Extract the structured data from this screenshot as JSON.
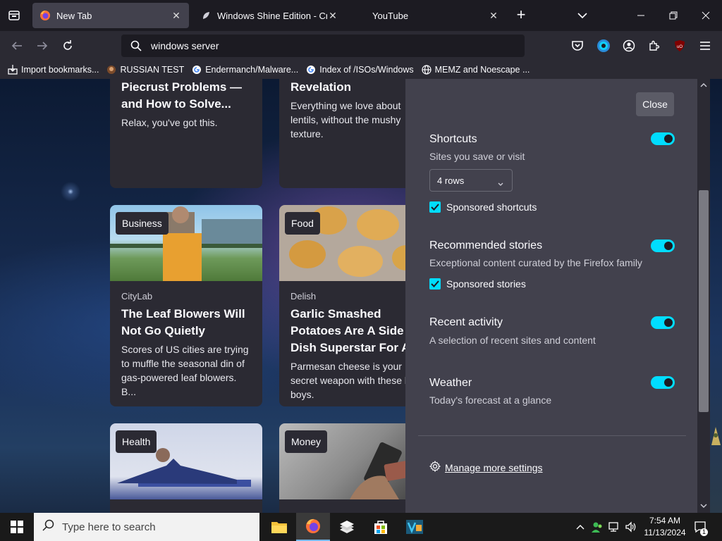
{
  "browser": {
    "tabs": [
      {
        "title": "New Tab",
        "active": true
      },
      {
        "title": "Windows Shine Edition - Crusty",
        "active": false
      },
      {
        "title": "YouTube",
        "active": false
      }
    ],
    "url_value": "windows server",
    "bookmarks": [
      {
        "label": "Import bookmarks..."
      },
      {
        "label": "RUSSIAN TEST"
      },
      {
        "label": "Endermanch/Malware..."
      },
      {
        "label": "Index of /ISOs/Windows"
      },
      {
        "label": "MEMZ and Noescape ..."
      }
    ],
    "accent": "#00ddff"
  },
  "cards": [
    {
      "headline": "Piecrust Problems — and How to Solve...",
      "excerpt": "Relax, you've got this."
    },
    {
      "headline": "Revelation",
      "excerpt": "Everything we love about lentils, without the mushy texture."
    },
    {
      "tag": "Business",
      "source": "CityLab",
      "headline": "The Leaf Blowers Will Not Go Quietly",
      "excerpt": "Scores of US cities are trying to muffle the seasonal din of gas-powered leaf blowers. B..."
    },
    {
      "tag": "Food",
      "source": "Delish",
      "headline": "Garlic Smashed Potatoes Are A Side Dish Superstar For Ar",
      "excerpt": "Parmesan cheese is your secret weapon with these b boys."
    },
    {
      "tag": "Health"
    },
    {
      "tag": "Money"
    }
  ],
  "settings": {
    "close_label": "Close",
    "shortcuts": {
      "title": "Shortcuts",
      "subtitle": "Sites you save or visit",
      "rows": "4 rows",
      "sponsored": "Sponsored shortcuts"
    },
    "stories": {
      "title": "Recommended stories",
      "subtitle": "Exceptional content curated by the Firefox family",
      "sponsored": "Sponsored stories"
    },
    "recent": {
      "title": "Recent activity",
      "subtitle": "A selection of recent sites and content"
    },
    "weather": {
      "title": "Weather",
      "subtitle": "Today's forecast at a glance"
    },
    "manage_label": "Manage more settings"
  },
  "taskbar": {
    "search_placeholder": "Type here to search",
    "time": "7:54 AM",
    "date": "11/13/2024",
    "notification_count": "1"
  }
}
